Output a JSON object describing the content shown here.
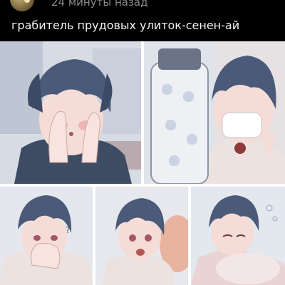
{
  "post": {
    "time_label": "24 минуты назад",
    "text": "грабитель прудовых улиток-сенен-ай"
  },
  "colors": {
    "background": "#000000",
    "time_text": "#8a8a8a",
    "post_text": "#f2f2f2",
    "hair": "#4a5a78",
    "skin": "#f6dcd6",
    "blush": "#e9a3a8",
    "coat": "#ece2df",
    "sweater": "#3e4c63"
  },
  "icons": {
    "avatar": "author-avatar-icon"
  },
  "panels": [
    {
      "id": "p1",
      "name": "panel-boy-covering-face"
    },
    {
      "id": "p2",
      "name": "panel-boy-with-masked-face-and-bottle"
    },
    {
      "id": "p3",
      "name": "panel-boy-covering-mouth"
    },
    {
      "id": "p4",
      "name": "panel-two-characters-surprised"
    },
    {
      "id": "p5",
      "name": "panel-boy-hugging-pillow"
    }
  ]
}
